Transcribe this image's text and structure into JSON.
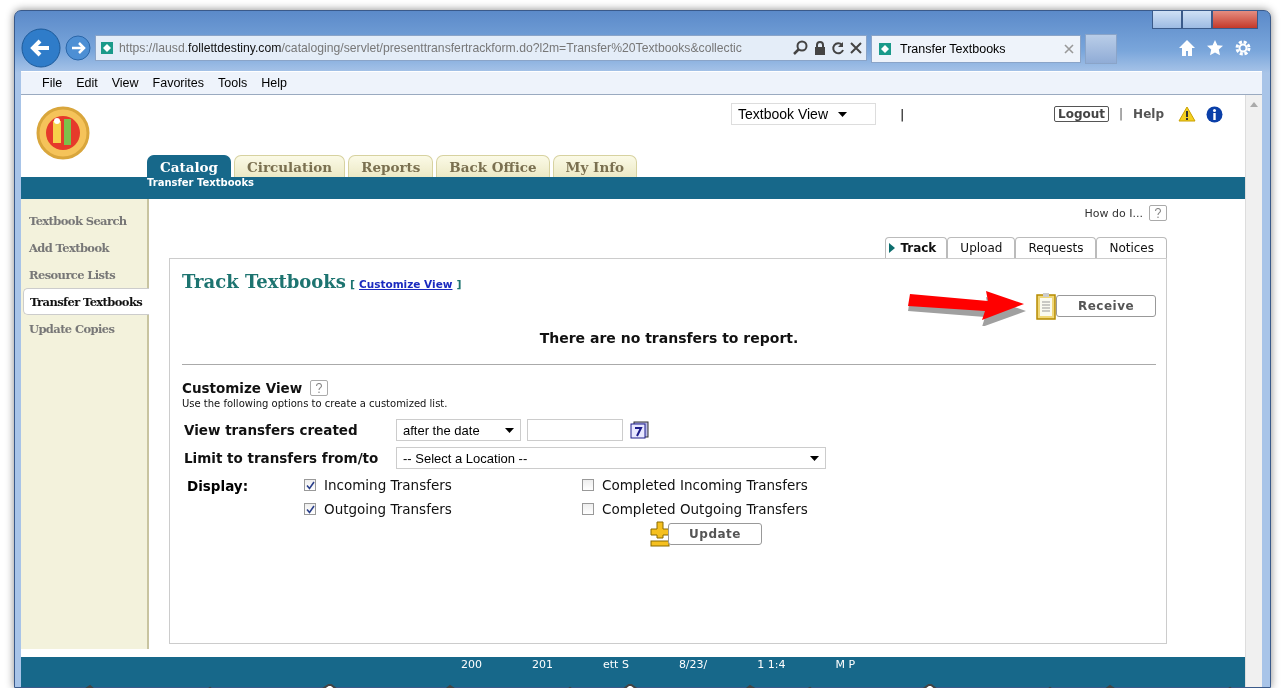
{
  "browser": {
    "url": "https://lausd.**follettdestiny.com**/cataloging/servlet/presenttransfertrackform.do?l2m=Transfer%20Textbooks&collectic",
    "tab_title": "Transfer Textbooks",
    "menu": [
      "File",
      "Edit",
      "View",
      "Favorites",
      "Tools",
      "Help"
    ]
  },
  "header": {
    "view_select": "Textbook View",
    "separator": "|",
    "logout": "Logout",
    "separator_2": "|",
    "help": "Help"
  },
  "tabs": [
    {
      "label": "Catalog",
      "selected": true
    },
    {
      "label": "Circulation",
      "selected": false
    },
    {
      "label": "Reports",
      "selected": false
    },
    {
      "label": "Back Office",
      "selected": false
    },
    {
      "label": "My Info",
      "selected": false
    }
  ],
  "subnav": "Transfer Textbooks",
  "sidebar": {
    "items": [
      {
        "label": "Textbook Search",
        "selected": false
      },
      {
        "label": "Add Textbook",
        "selected": false
      },
      {
        "label": "Resource Lists",
        "selected": false
      },
      {
        "label": "Transfer Textbooks",
        "selected": true
      },
      {
        "label": "Update Copies",
        "selected": false
      }
    ]
  },
  "how_do_i": "How do I...",
  "page_tabs": [
    {
      "label": "Track",
      "selected": true
    },
    {
      "label": "Upload",
      "selected": false
    },
    {
      "label": "Requests",
      "selected": false
    },
    {
      "label": "Notices",
      "selected": false
    }
  ],
  "panel": {
    "title": "Track Textbooks",
    "bracket_open": "[",
    "customize_link": "Customize View",
    "bracket_close": "]",
    "receive_button": "Receive",
    "message": "There are no transfers to report."
  },
  "customize": {
    "heading": "Customize View",
    "description": "Use the following options to create a customized list.",
    "created_label": "View transfers created",
    "created_select": "after the date",
    "limit_label": "Limit to transfers from/to",
    "limit_select": "-- Select a Location --",
    "display_label": "Display:",
    "options": [
      {
        "label": "Incoming Transfers",
        "checked": true
      },
      {
        "label": "Completed Incoming Transfers",
        "checked": false
      },
      {
        "label": "Outgoing Transfers",
        "checked": true
      },
      {
        "label": "Completed Outgoing Transfers",
        "checked": false
      }
    ],
    "update_button": "Update"
  },
  "footer": [
    "200",
    "201",
    "ett S",
    "8/23/",
    "1 1:4",
    "M P"
  ]
}
